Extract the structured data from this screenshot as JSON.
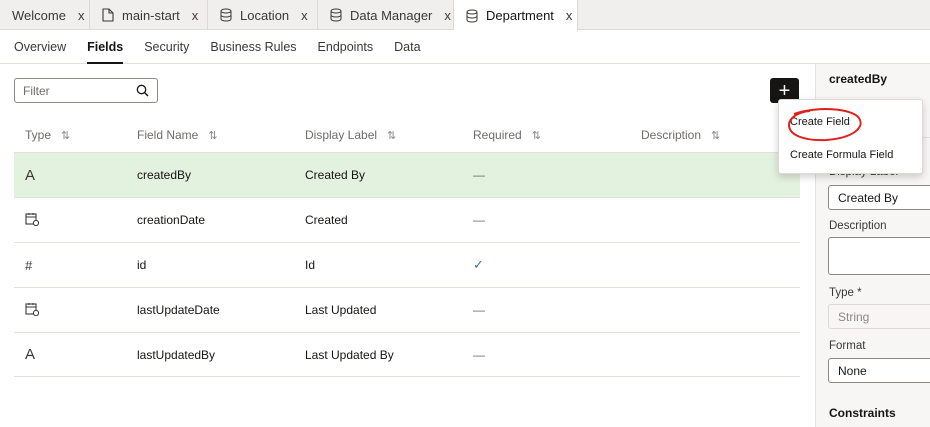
{
  "tabs": [
    {
      "label": "Welcome",
      "icon": "none",
      "active": false
    },
    {
      "label": "main-start",
      "icon": "document-icon",
      "active": false
    },
    {
      "label": "Location",
      "icon": "database-icon",
      "active": false
    },
    {
      "label": "Data Manager",
      "icon": "database-icon",
      "active": false
    },
    {
      "label": "Department",
      "icon": "database-icon",
      "active": true
    }
  ],
  "close_glyph": "x",
  "subnav": [
    "Overview",
    "Fields",
    "Security",
    "Business Rules",
    "Endpoints",
    "Data"
  ],
  "subnav_active": "Fields",
  "filter": {
    "placeholder": "Filter",
    "value": ""
  },
  "add_button": {
    "label": "+"
  },
  "columns": [
    "Type",
    "Field Name",
    "Display Label",
    "Required",
    "Description"
  ],
  "rows": [
    {
      "type_icon": "text-type-icon",
      "type_glyph": "A",
      "name": "createdBy",
      "label": "Created By",
      "required": "—",
      "description": "",
      "selected": true
    },
    {
      "type_icon": "datetime-type-icon",
      "type_glyph": "",
      "name": "creationDate",
      "label": "Created",
      "required": "—",
      "description": "",
      "selected": false
    },
    {
      "type_icon": "number-type-icon",
      "type_glyph": "#",
      "name": "id",
      "label": "Id",
      "required": "✓",
      "description": "",
      "selected": false
    },
    {
      "type_icon": "datetime-type-icon",
      "type_glyph": "",
      "name": "lastUpdateDate",
      "label": "Last Updated",
      "required": "—",
      "description": "",
      "selected": false
    },
    {
      "type_icon": "text-type-icon",
      "type_glyph": "A",
      "name": "lastUpdatedBy",
      "label": "Last Updated By",
      "required": "—",
      "description": "",
      "selected": false
    }
  ],
  "menu": {
    "items": [
      "Create Field",
      "Create Formula Field"
    ]
  },
  "panel": {
    "title": "createdBy",
    "display_label_label": "Display Label",
    "display_label_value": "Created By",
    "description_label": "Description",
    "type_label": "Type *",
    "type_value": "String",
    "format_label": "Format",
    "format_value": "None",
    "constraints_label": "Constraints"
  },
  "colors": {
    "selected_row": "#e3f1df",
    "annotation": "#e0201a",
    "dark": "#161513"
  }
}
